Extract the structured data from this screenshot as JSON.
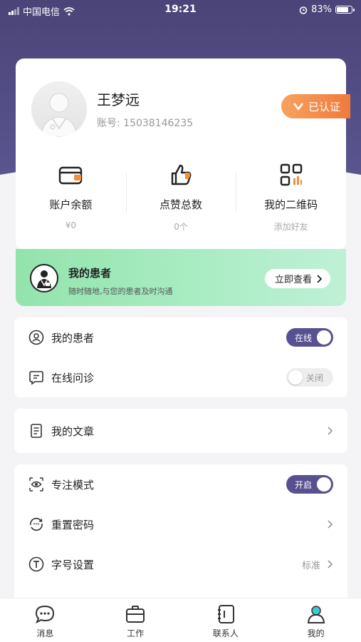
{
  "status_bar": {
    "carrier": "中国电信",
    "time": "19:21",
    "battery": "83%",
    "battery_level": 0.83
  },
  "profile": {
    "name": "王梦远",
    "account_label": "账号:",
    "account_number": "15038146235",
    "verified_label": "已认证"
  },
  "stats": [
    {
      "label": "账户余额",
      "value": "¥0",
      "icon": "wallet-icon"
    },
    {
      "label": "点赞总数",
      "value": "0个",
      "icon": "thumbs-up-icon"
    },
    {
      "label": "我的二维码",
      "value": "添加好友",
      "icon": "qr-code-icon"
    }
  ],
  "banner": {
    "title": "我的患者",
    "subtitle": "随时随地,与您的患者及时沟通",
    "button_label": "立即查看"
  },
  "section1": {
    "rows": [
      {
        "label": "我的患者",
        "icon": "user-circle-icon",
        "toggle": "在线",
        "state": "on"
      },
      {
        "label": "在线问诊",
        "icon": "chat-icon",
        "toggle": "关闭",
        "state": "off"
      }
    ]
  },
  "section2": {
    "rows": [
      {
        "label": "我的文章",
        "icon": "document-icon"
      }
    ]
  },
  "section3": {
    "rows": [
      {
        "label": "专注模式",
        "icon": "eye-focus-icon",
        "toggle": "开启",
        "state": "on"
      },
      {
        "label": "重置密码",
        "icon": "password-icon"
      },
      {
        "label": "字号设置",
        "icon": "font-size-icon",
        "value": "标准"
      }
    ]
  },
  "tabbar": {
    "tabs": [
      {
        "label": "消息",
        "icon": "message-icon"
      },
      {
        "label": "工作",
        "icon": "briefcase-icon"
      },
      {
        "label": "联系人",
        "icon": "contacts-icon"
      },
      {
        "label": "我的",
        "icon": "profile-icon",
        "active": true
      }
    ]
  },
  "colors": {
    "header": "#4a4478",
    "toggle_on": "#575091",
    "badge": "#f07a3c",
    "banner": "#93e3ad",
    "active_tab": "#3ec7d8"
  }
}
